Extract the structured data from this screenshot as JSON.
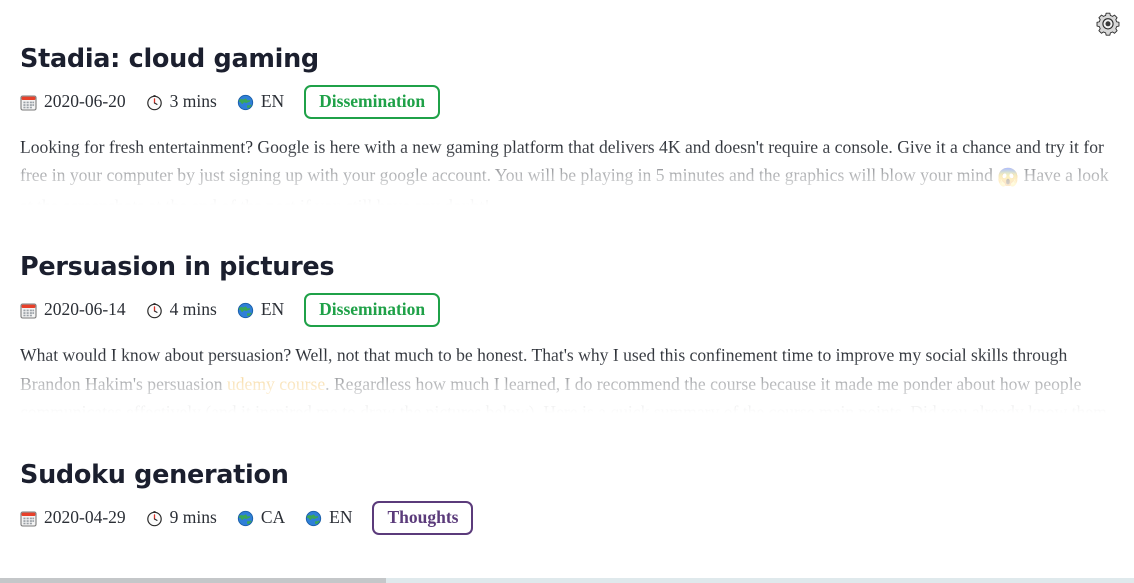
{
  "header": {
    "settings_icon": "gear-icon",
    "settings_label": "Settings"
  },
  "icons": {
    "date": "calendar-icon",
    "duration": "clock-icon",
    "language": "globe-icon"
  },
  "colors": {
    "tag_green": "#1fa148",
    "tag_purple": "#5b3b7b",
    "heading": "#1b1f2e",
    "link_amber": "#f0b441",
    "progress_track": "#dfe9ec",
    "progress_fill": "#c4c7c9"
  },
  "progress": {
    "percent": 34,
    "label": "34%"
  },
  "posts": [
    {
      "title": "Stadia: cloud gaming",
      "date": "2020-06-20",
      "reading_time": "3 mins",
      "languages": [
        "EN"
      ],
      "tag": "Dissemination",
      "tag_color": "green",
      "excerpt_before_link": "Looking for fresh entertainment? Google is here with a new gaming platform that delivers 4K and doesn't require a console. Give it a chance and try it for free in your computer by just signing up with your google account. You will be playing in 5 minutes and the graphics will blow your mind ",
      "excerpt_emoji": "😱",
      "excerpt_link_text": "",
      "excerpt_after_link": " Have a look at the screenshots at the end of the post if you still have any doubt!"
    },
    {
      "title": "Persuasion in pictures",
      "date": "2020-06-14",
      "reading_time": "4 mins",
      "languages": [
        "EN"
      ],
      "tag": "Dissemination",
      "tag_color": "green",
      "excerpt_before_link": "What would I know about persuasion? Well, not that much to be honest. That's why I used this confinement time to improve my social skills through Brandon Hakim's persuasion ",
      "excerpt_emoji": "",
      "excerpt_link_text": "udemy course",
      "excerpt_after_link": ". Regardless how much I learned, I do recommend the course because it made me ponder about how people communicates effectively (and it inspired me to draw the pictures below). Here is a quick summary of the course main points. Did you already know them all?"
    },
    {
      "title": "Sudoku generation",
      "date": "2020-04-29",
      "reading_time": "9 mins",
      "languages": [
        "CA",
        "EN"
      ],
      "tag": "Thoughts",
      "tag_color": "purple",
      "excerpt_before_link": "",
      "excerpt_emoji": "",
      "excerpt_link_text": "",
      "excerpt_after_link": ""
    }
  ]
}
